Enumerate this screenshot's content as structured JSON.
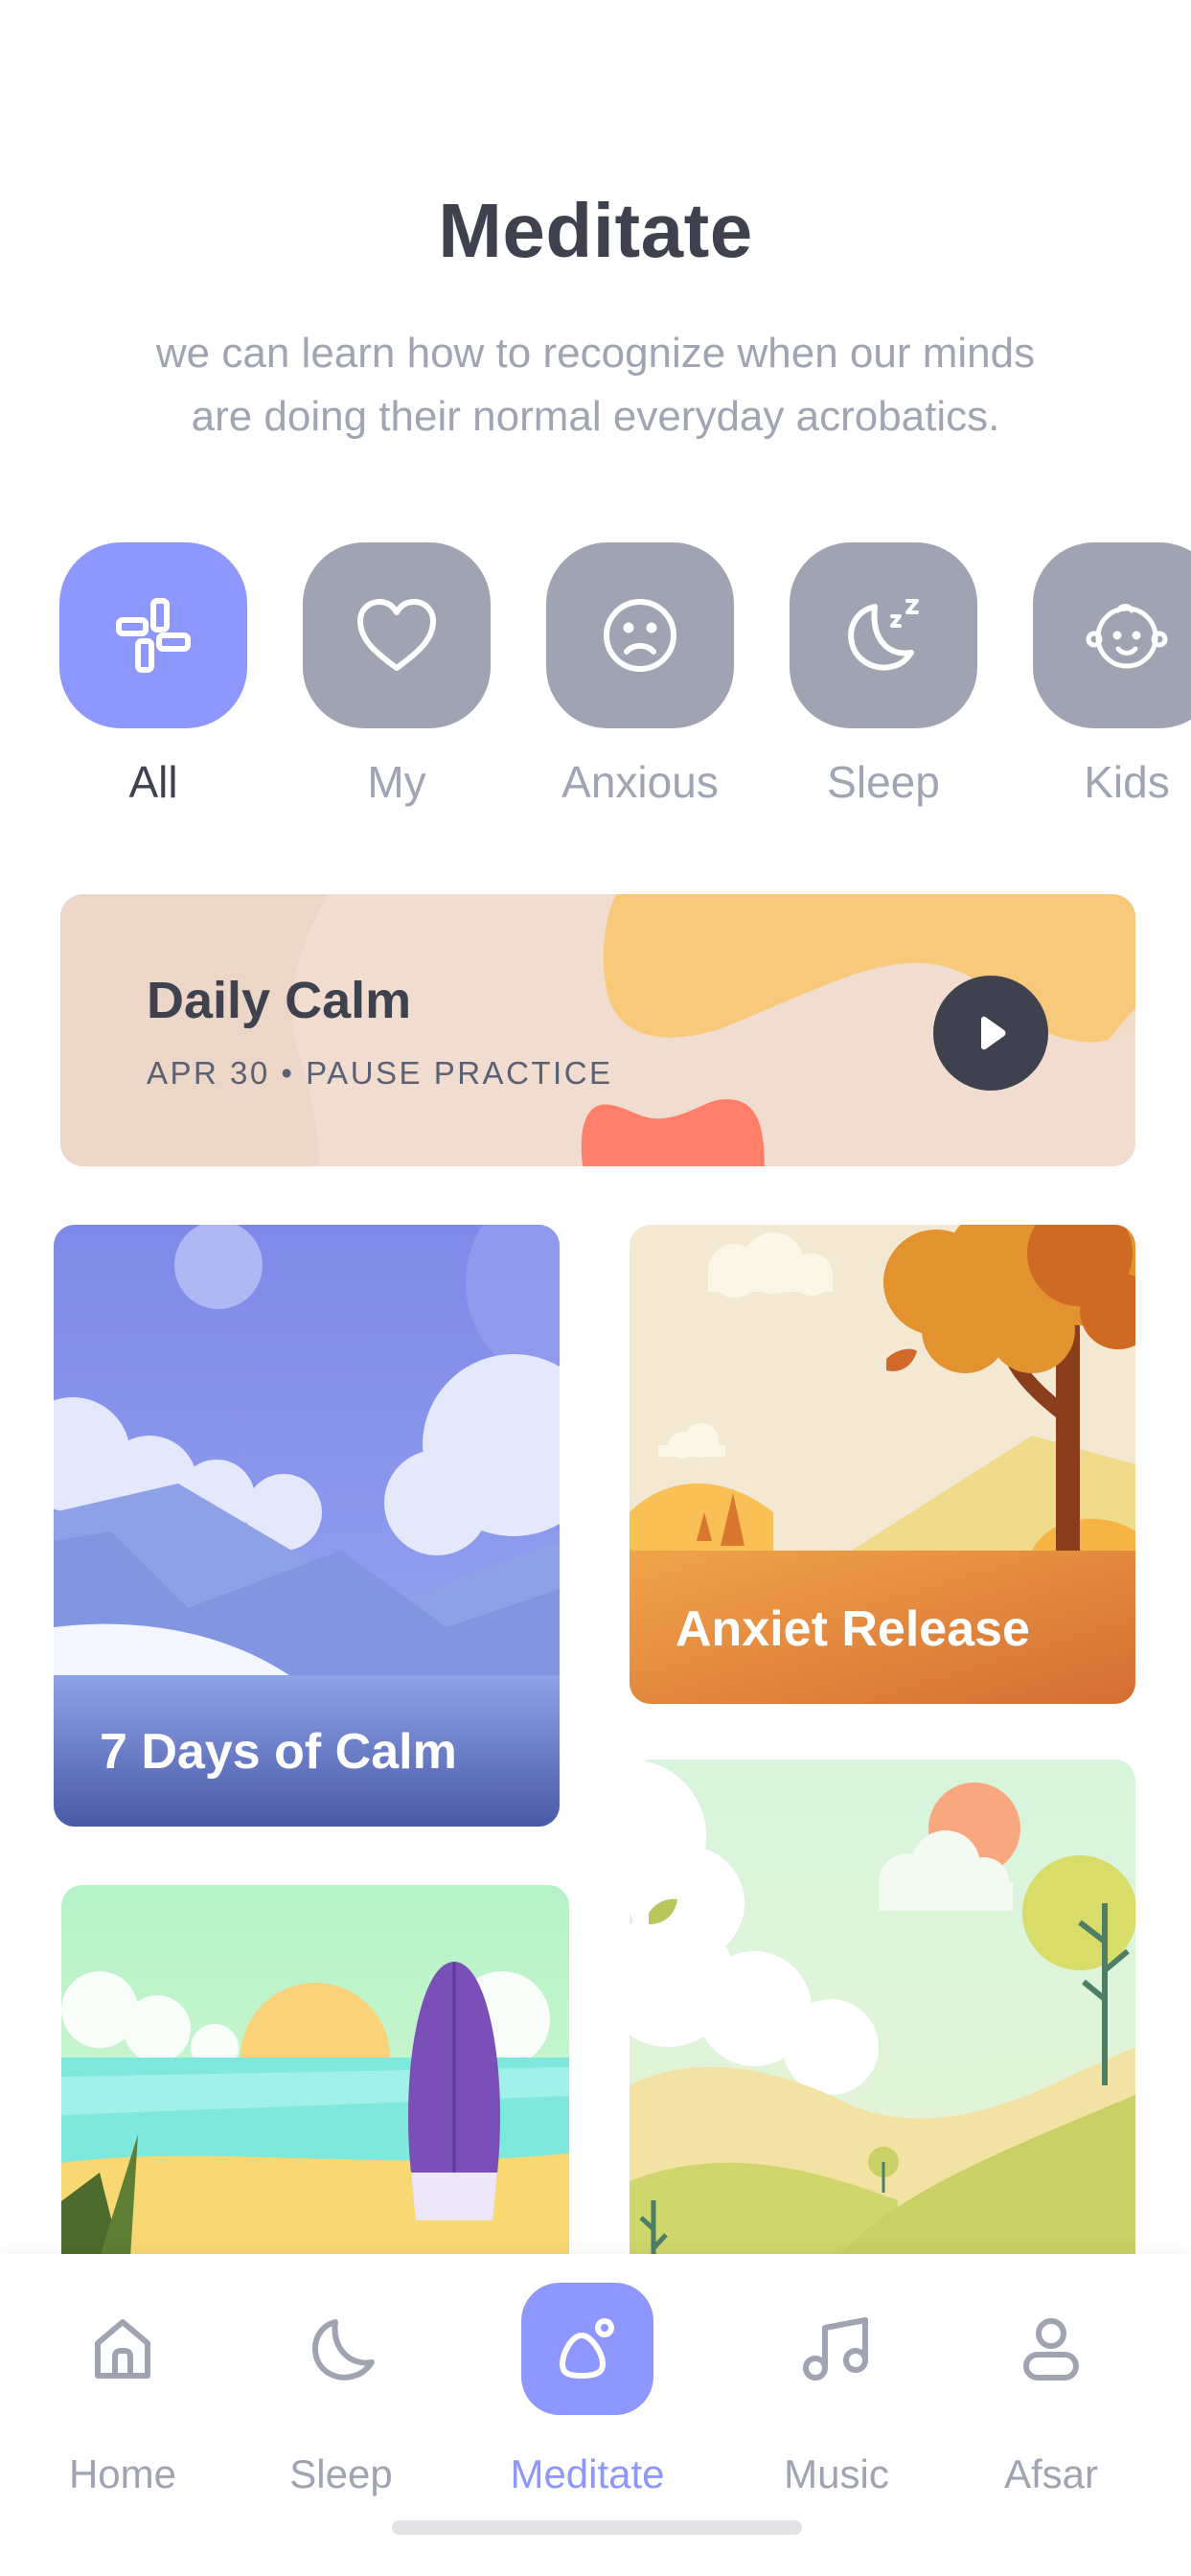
{
  "header": {
    "title": "Meditate",
    "subtitle_line1": "we can learn how to recognize when our minds",
    "subtitle_line2": "are doing their normal everyday acrobatics."
  },
  "categories": [
    {
      "label": "All",
      "icon": "grid-icon",
      "active": true
    },
    {
      "label": "My",
      "icon": "heart-icon",
      "active": false
    },
    {
      "label": "Anxious",
      "icon": "sad-face-icon",
      "active": false
    },
    {
      "label": "Sleep",
      "icon": "moon-zzz-icon",
      "active": false
    },
    {
      "label": "Kids",
      "icon": "baby-face-icon",
      "active": false
    }
  ],
  "daily_calm": {
    "title": "Daily Calm",
    "subtitle": "APR 30 • PAUSE PRACTICE",
    "play_icon": "play-icon"
  },
  "cards": [
    {
      "title": "7 Days of Calm"
    },
    {
      "title": "Anxiet Release"
    },
    {
      "title": ""
    },
    {
      "title": ""
    }
  ],
  "nav": {
    "items": [
      {
        "label": "Home",
        "icon": "home-icon",
        "active": false
      },
      {
        "label": "Sleep",
        "icon": "moon-icon",
        "active": false
      },
      {
        "label": "Meditate",
        "icon": "meditate-icon",
        "active": true
      },
      {
        "label": "Music",
        "icon": "music-icon",
        "active": false
      },
      {
        "label": "Afsar",
        "icon": "user-icon",
        "active": false
      }
    ]
  },
  "colors": {
    "accent": "#8E97FD",
    "chip_inactive": "#A0A3B1",
    "text_dark": "#3F414E",
    "text_muted": "#A1A4B2"
  }
}
